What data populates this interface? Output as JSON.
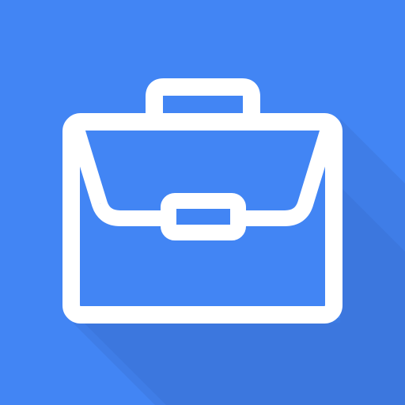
{
  "icon": {
    "name": "briefcase-icon",
    "colors": {
      "background": "#4285F4",
      "long_shadow": "#3B73D6",
      "glyph": "#FFFFFF"
    }
  }
}
